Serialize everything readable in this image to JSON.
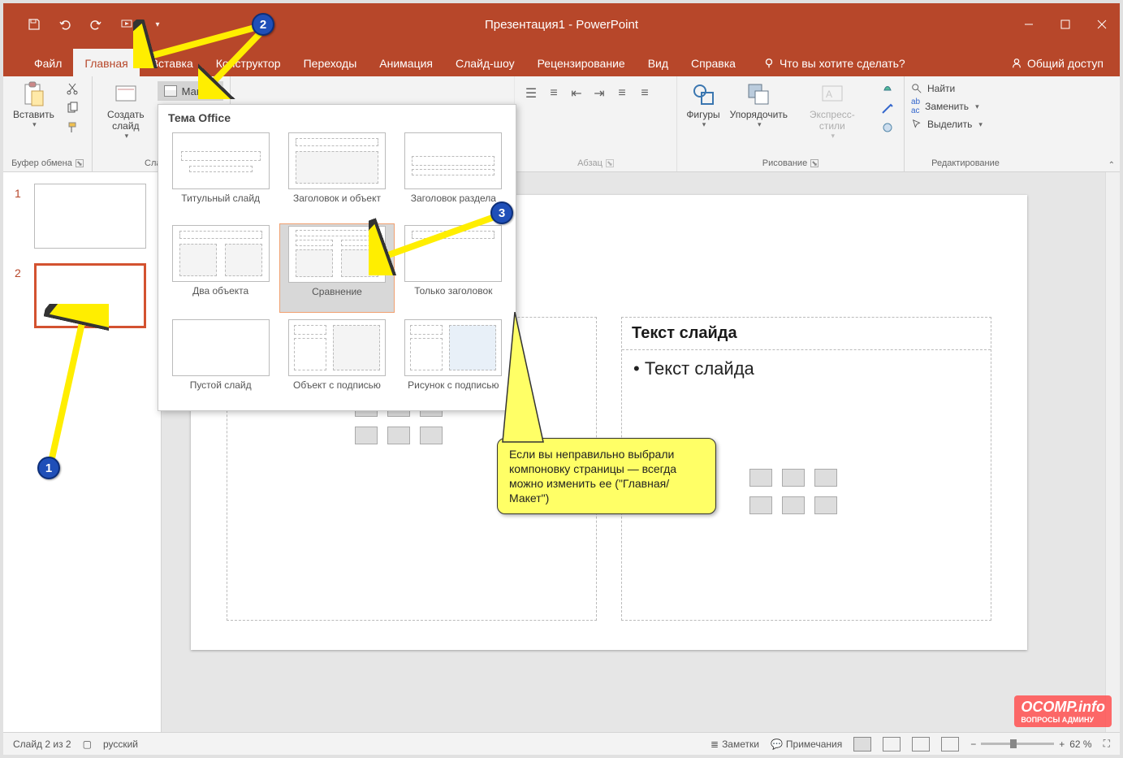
{
  "title": "Презентация1 - PowerPoint",
  "tabs": [
    "Файл",
    "Главная",
    "Вставка",
    "Конструктор",
    "Переходы",
    "Анимация",
    "Слайд-шоу",
    "Рецензирование",
    "Вид",
    "Справка"
  ],
  "active_tab": 1,
  "tell_me": "Что вы хотите сделать?",
  "share": "Общий доступ",
  "groups": {
    "clipboard": {
      "label": "Буфер обмена",
      "paste": "Вставить"
    },
    "slides": {
      "label": "Слайды",
      "new_slide": "Создать слайд",
      "layout": "Макет"
    },
    "paragraph": {
      "label": "Абзац"
    },
    "drawing": {
      "label": "Рисование",
      "shapes": "Фигуры",
      "arrange": "Упорядочить",
      "styles": "Экспресс-стили"
    },
    "editing": {
      "label": "Редактирование",
      "find": "Найти",
      "replace": "Заменить",
      "select": "Выделить"
    }
  },
  "gallery": {
    "title": "Тема Office",
    "items": [
      "Титульный слайд",
      "Заголовок и объект",
      "Заголовок раздела",
      "Два объекта",
      "Сравнение",
      "Только заголовок",
      "Пустой слайд",
      "Объект с подписью",
      "Рисунок с подписью"
    ],
    "selected": 4
  },
  "thumbs": {
    "count": 2,
    "selected": 2
  },
  "slide": {
    "title_partial": "да",
    "subtitle": "Текст слайда",
    "bullet": "Текст слайда"
  },
  "statusbar": {
    "slide": "Слайд 2 из 2",
    "lang": "русский",
    "notes": "Заметки",
    "comments": "Примечания",
    "zoom": "62 %"
  },
  "annotations": {
    "m1": "1",
    "m2": "2",
    "m3": "3",
    "callout": "Если вы неправильно выбрали компоновку страницы — всегда можно изменить ее (\"Главная/Макет\")"
  },
  "watermark": {
    "top": "OCOMP.info",
    "bottom": "ВОПРОСЫ АДМИНУ"
  }
}
